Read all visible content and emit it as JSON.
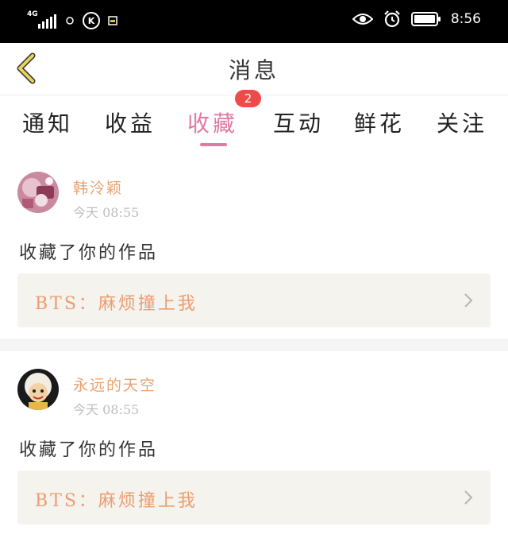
{
  "status_bar": {
    "network": "4G",
    "time": "8:56",
    "k_icon": "K"
  },
  "header": {
    "title": "消息",
    "back_icon": "chevron-left-icon"
  },
  "tabs": [
    {
      "label": "通知"
    },
    {
      "label": "收益"
    },
    {
      "label": "收藏"
    },
    {
      "label": "互动"
    },
    {
      "label": "鲜花"
    },
    {
      "label": "关注"
    }
  ],
  "active_tab": "收藏",
  "badge": {
    "count": "2"
  },
  "notifications": [
    {
      "username": "韩泠颖",
      "timestamp": "今天 08:55",
      "action": "收藏了你的作品",
      "work_title": "BTS：麻烦撞上我"
    },
    {
      "username": "永远的天空",
      "timestamp": "今天 08:55",
      "action": "收藏了你的作品",
      "work_title": "BTS：麻烦撞上我"
    }
  ],
  "colors": {
    "accent": "#e07aa2",
    "username": "#e8a271",
    "work_title": "#ee9c6f",
    "badge": "#ef4a4a",
    "back_arrow": "#e9d45a"
  }
}
